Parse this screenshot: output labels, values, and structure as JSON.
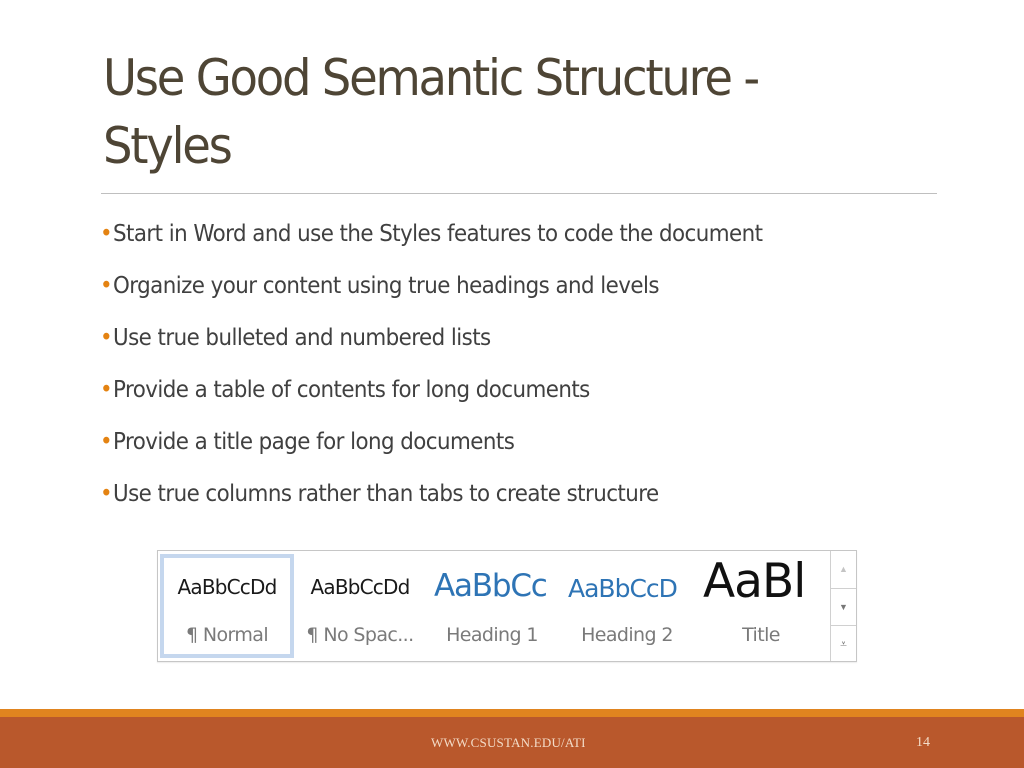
{
  "slide": {
    "title_line1": "Use Good Semantic Structure -",
    "title_line2": "Styles",
    "bullet_glyph": "•",
    "bullets": [
      "Start in Word and use the Styles features to code the document",
      "Organize your content using true headings and levels",
      "Use true bulleted and numbered lists",
      "Provide a table of contents for long documents",
      "Provide a title page for long documents",
      "Use true columns rather than tabs to create structure"
    ],
    "colors": {
      "title": "#4e4535",
      "text": "#404040",
      "bullet": "#e48312",
      "footer_stripe": "#e0841f",
      "footer_bg": "#b9582c",
      "heading_blue": "#2e74b5"
    }
  },
  "styles_gallery": {
    "selected": "Normal",
    "items": [
      {
        "sample": "AaBbCcDd",
        "label": "¶ Normal"
      },
      {
        "sample": "AaBbCcDd",
        "label": "¶ No Spac..."
      },
      {
        "sample": "AaBbCc",
        "label": "Heading 1"
      },
      {
        "sample": "AaBbCcD",
        "label": "Heading 2"
      },
      {
        "sample": "AaBl",
        "label": "Title"
      }
    ],
    "scroll": {
      "up": "▲",
      "down": "▼",
      "more": "⩡"
    }
  },
  "footer": {
    "url": "WWW.CSUSTAN.EDU/ATI",
    "page_number": "14"
  }
}
